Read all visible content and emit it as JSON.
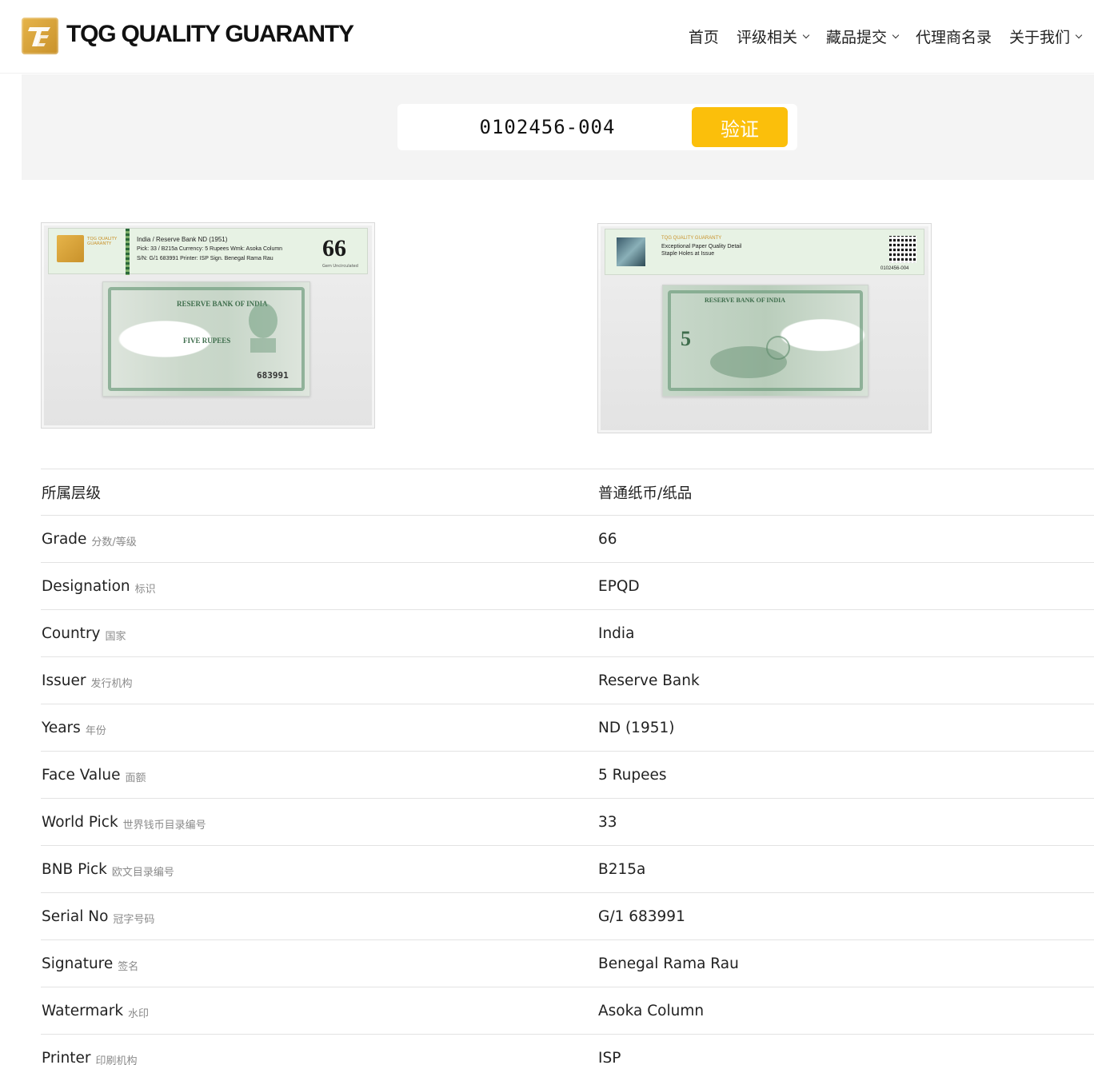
{
  "header": {
    "brand": "TQG QUALITY GUARANTY",
    "logo_icon": "tqg-logo-icon",
    "nav": [
      {
        "label": "首页",
        "has_dropdown": false
      },
      {
        "label": "评级相关",
        "has_dropdown": true
      },
      {
        "label": "藏品提交",
        "has_dropdown": true
      },
      {
        "label": "代理商名录",
        "has_dropdown": false
      },
      {
        "label": "关于我们",
        "has_dropdown": true
      }
    ]
  },
  "search": {
    "value": "0102456-004",
    "button_label": "验证",
    "button_color": "#fbbf0b"
  },
  "images": {
    "front": {
      "label_line1": "India / Reserve Bank    ND (1951)",
      "label_line2": "Pick: 33 / B215a    Currency: 5 Rupees    Wmk: Asoka Column",
      "label_line3": "S/N: G/1 683991    Printer: ISP    Sign. Benegal Rama Rau",
      "label_brand": "TQG QUALITY GUARANTY",
      "grade": "66",
      "grade_text": "Gem Uncirculated",
      "note_title": "RESERVE BANK OF INDIA",
      "note_value": "FIVE RUPEES",
      "note_serial": "683991"
    },
    "back": {
      "label_brand": "TQG QUALITY GUARANTY",
      "label_line1": "Exceptional Paper Quality Detail",
      "label_line2": "Staple Holes at Issue",
      "cert_number": "0102456-004",
      "note_title": "RESERVE BANK OF INDIA",
      "note_value": "5"
    }
  },
  "details": [
    {
      "label": "所属层级",
      "sub": "",
      "value": "普通纸币/纸品"
    },
    {
      "label": "Grade",
      "sub": "分数/等级",
      "value": "66"
    },
    {
      "label": "Designation",
      "sub": "标识",
      "value": "EPQD"
    },
    {
      "label": "Country",
      "sub": "国家",
      "value": "India"
    },
    {
      "label": "Issuer",
      "sub": "发行机构",
      "value": "Reserve Bank"
    },
    {
      "label": "Years",
      "sub": "年份",
      "value": "ND (1951)"
    },
    {
      "label": "Face Value",
      "sub": "面额",
      "value": "5 Rupees"
    },
    {
      "label": "World Pick",
      "sub": "世界钱币目录编号",
      "value": "33"
    },
    {
      "label": "BNB Pick",
      "sub": "欧文目录编号",
      "value": "B215a"
    },
    {
      "label": "Serial No",
      "sub": "冠字号码",
      "value": "G/1 683991"
    },
    {
      "label": "Signature",
      "sub": "签名",
      "value": "Benegal Rama Rau"
    },
    {
      "label": "Watermark",
      "sub": "水印",
      "value": "Asoka Column"
    },
    {
      "label": "Printer",
      "sub": "印刷机构",
      "value": "ISP"
    }
  ]
}
